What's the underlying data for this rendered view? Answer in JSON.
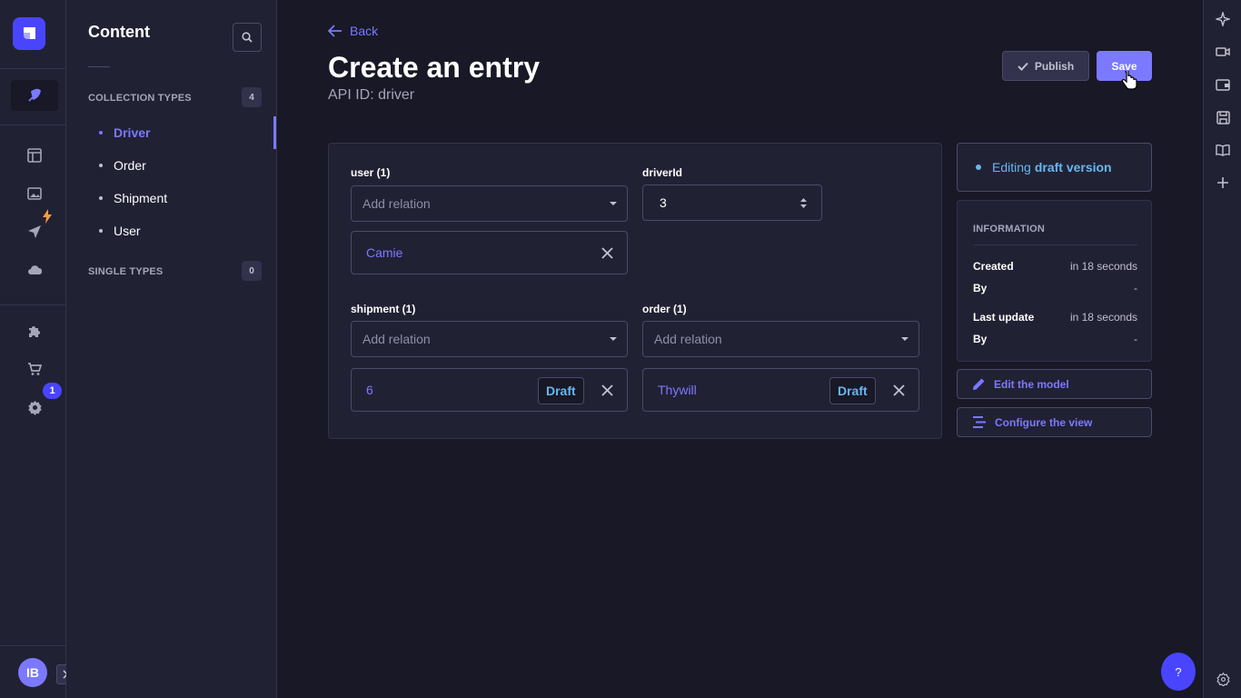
{
  "left_rail": {
    "badge_count": "1",
    "user_initials": "IB"
  },
  "subnav": {
    "title": "Content",
    "collection_types_label": "COLLECTION TYPES",
    "collection_types_count": "4",
    "collection_items": [
      "Driver",
      "Order",
      "Shipment",
      "User"
    ],
    "single_types_label": "SINGLE TYPES",
    "single_types_count": "0"
  },
  "header": {
    "back_label": "Back",
    "title": "Create an entry",
    "api_id": "API ID: driver",
    "publish_label": "Publish",
    "save_label": "Save"
  },
  "form": {
    "user": {
      "label": "user (1)",
      "placeholder": "Add relation",
      "related_item": "Camie"
    },
    "driverId": {
      "label": "driverId",
      "value": "3"
    },
    "shipment": {
      "label": "shipment (1)",
      "placeholder": "Add relation",
      "related_item": "6",
      "status": "Draft"
    },
    "order": {
      "label": "order (1)",
      "placeholder": "Add relation",
      "related_item": "Thywill",
      "status": "Draft"
    }
  },
  "sidebar": {
    "status_prefix": "Editing",
    "status_value": "draft version",
    "info_title": "INFORMATION",
    "info_rows": [
      {
        "key": "Created",
        "value": "in 18 seconds"
      },
      {
        "key": "By",
        "value": "-"
      },
      {
        "key": "Last update",
        "value": "in 18 seconds"
      },
      {
        "key": "By",
        "value": "-"
      }
    ],
    "edit_model_label": "Edit the model",
    "configure_view_label": "Configure the view"
  },
  "help_label": "?",
  "colors": {
    "accent": "#7b79ff",
    "primary": "#4945ff",
    "draft": "#66b7f1",
    "background": "#181826",
    "surface": "#212134"
  }
}
